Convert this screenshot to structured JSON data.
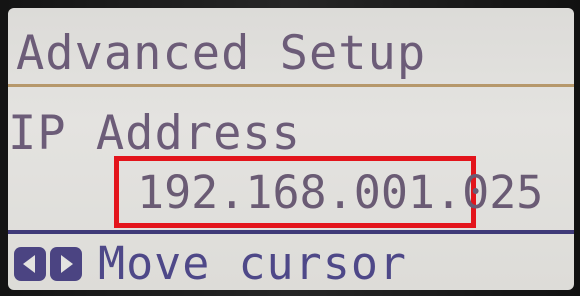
{
  "screen": {
    "title": "Advanced Setup",
    "field_label": "IP Address",
    "field_value": "192.168.001.025",
    "footer": {
      "keys": [
        "left-arrow-key-icon",
        "right-arrow-key-icon"
      ],
      "hint": "Move cursor"
    }
  },
  "colors": {
    "lcd_text": "#6c5c78",
    "accent_rule": "#b6986b",
    "footer_text": "#4e4888",
    "highlight_box": "#e3141b"
  }
}
